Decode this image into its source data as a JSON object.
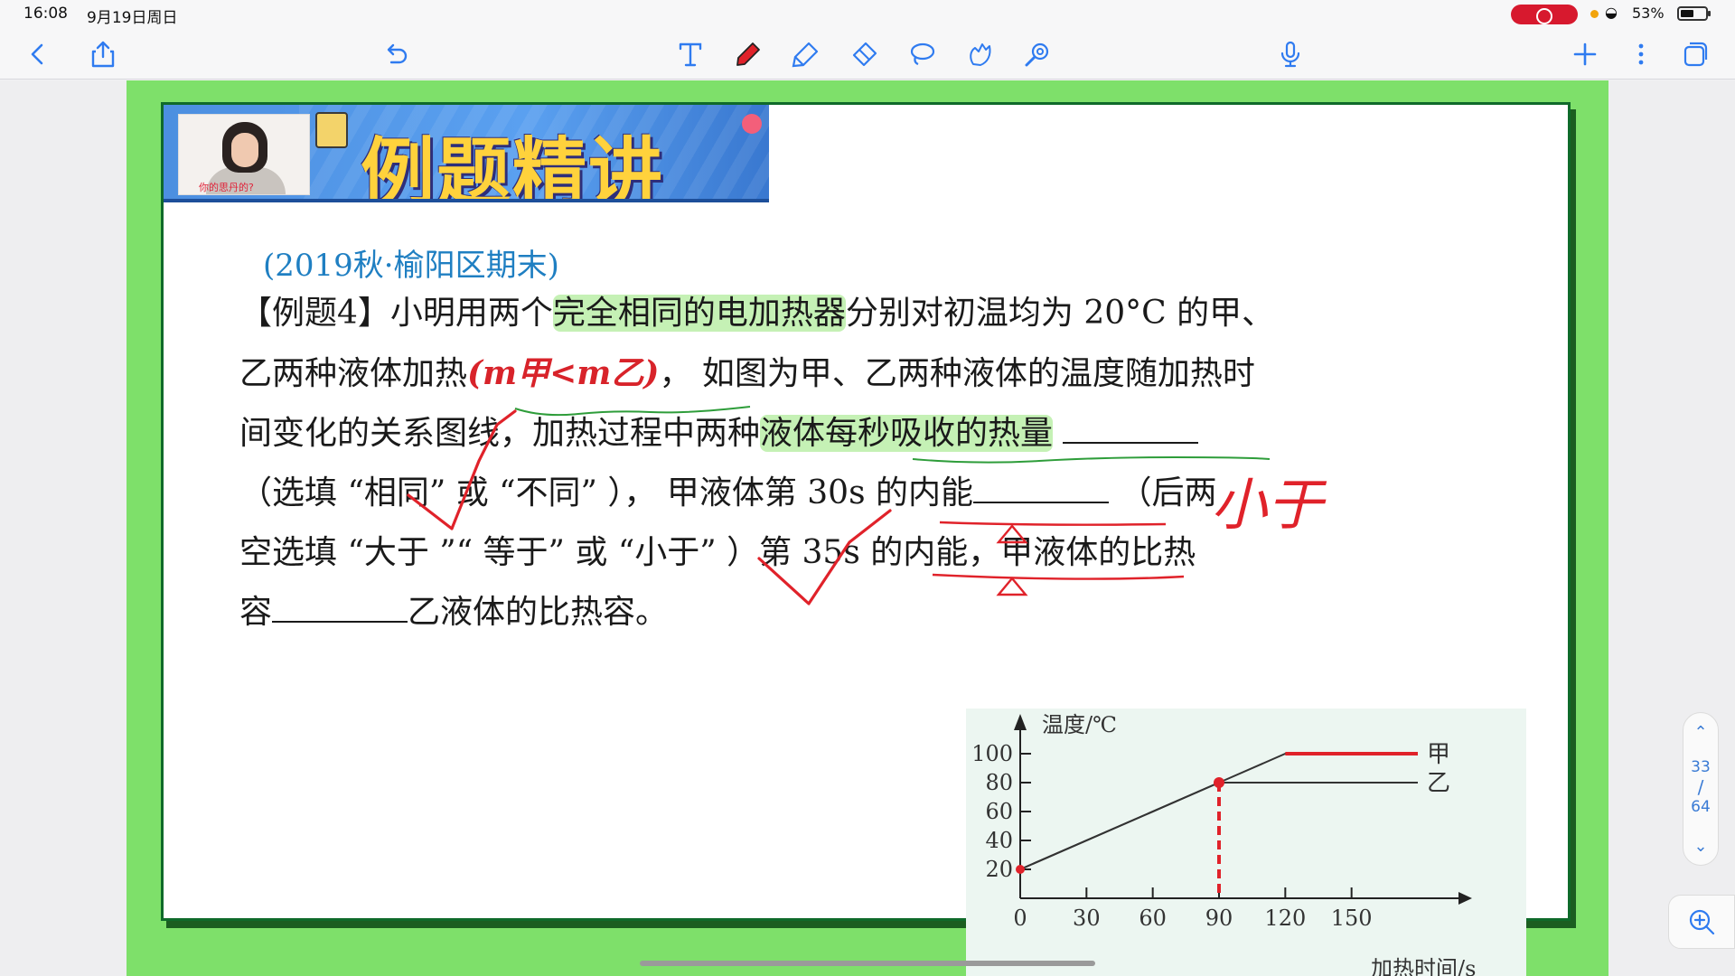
{
  "status_bar": {
    "time": "16:08",
    "date": "9月19日周日",
    "battery_percent": "53%",
    "battery_level": 0.53,
    "recording_color": "#d7192e"
  },
  "toolbar": {
    "left": [
      "back-icon",
      "share-icon",
      "undo-icon"
    ],
    "tools": [
      "text-tool-icon",
      "pen-tool-icon",
      "highlighter-tool-icon",
      "eraser-tool-icon",
      "lasso-tool-icon",
      "shape-tool-icon",
      "laser-pointer-icon"
    ],
    "right": [
      "microphone-icon",
      "add-page-icon",
      "more-options-icon",
      "page-overview-icon"
    ],
    "pen_color": "#e0222a"
  },
  "slide": {
    "banner_title": "例题精讲",
    "banner_video_caption": "你的思丹的?",
    "source": "(2019秋·榆阳区期末)",
    "question": {
      "line1_prefix": "【例题4】小明用两个",
      "line1_highlight": "完全相同的电加热器",
      "line1_suffix": "分别对初温均为 20°C 的甲、",
      "line2_prefix": "乙两种液体加热",
      "line2_mass_note": "(m甲<m乙)",
      "line2_suffix": "，  如图为甲、乙两种液体的温度随加热时",
      "line3_prefix": "间变化的关系图线，加热过程中两种",
      "line3_highlight": "液体每秒吸收的热量",
      "line4_a": "（选填  “相同”  或  “不同” ），  甲液体第 30s 的内能",
      "line4_b": "（后两",
      "line5": "空选填  “大于  ”“  等于”  或  “小于” ）第 35s 的内能，甲液体的比热",
      "line6_a": "容",
      "line6_b": "乙液体的比热容。"
    },
    "handwritten": {
      "answer_blank2": "小于"
    }
  },
  "chart_data": {
    "type": "line",
    "title": "",
    "ylabel": "温度/℃",
    "xlabel": "加热时间/s",
    "x_ticks": [
      0,
      30,
      60,
      90,
      120,
      150
    ],
    "y_ticks": [
      20,
      40,
      60,
      80,
      100
    ],
    "xlim": [
      0,
      180
    ],
    "ylim": [
      0,
      110
    ],
    "series": [
      {
        "name": "甲",
        "points": [
          [
            0,
            20
          ],
          [
            90,
            80
          ],
          [
            120,
            100
          ],
          [
            180,
            100
          ]
        ]
      },
      {
        "name": "乙",
        "points": [
          [
            0,
            20
          ],
          [
            90,
            80
          ],
          [
            180,
            80
          ]
        ]
      }
    ],
    "annotations": [
      {
        "kind": "red-dashed-vertical",
        "x": 90,
        "from_y": 0,
        "to_y": 80
      },
      {
        "kind": "red-overline",
        "series": "甲",
        "from_x": 120,
        "to_x": 180,
        "y": 100
      }
    ]
  },
  "pager": {
    "current": "33",
    "separator": "/",
    "total": "64"
  }
}
